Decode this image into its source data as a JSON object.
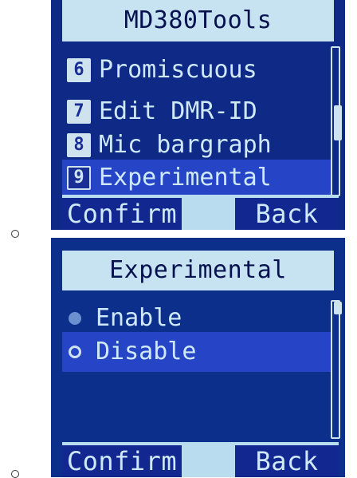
{
  "screen1": {
    "title": "MD380Tools",
    "items": [
      {
        "num": "6",
        "label": "Promiscuous"
      },
      {
        "num": "7",
        "label": "Edit DMR-ID"
      },
      {
        "num": "8",
        "label": "Mic bargraph"
      },
      {
        "num": "9",
        "label": "Experimental"
      }
    ],
    "selected_index": 3,
    "softkeys": {
      "left": "Confirm",
      "right": "Back"
    }
  },
  "screen2": {
    "title": "Experimental",
    "options": [
      {
        "label": "Enable",
        "state": "unselected"
      },
      {
        "label": "Disable",
        "state": "selected"
      }
    ],
    "softkeys": {
      "left": "Confirm",
      "right": "Back"
    }
  }
}
